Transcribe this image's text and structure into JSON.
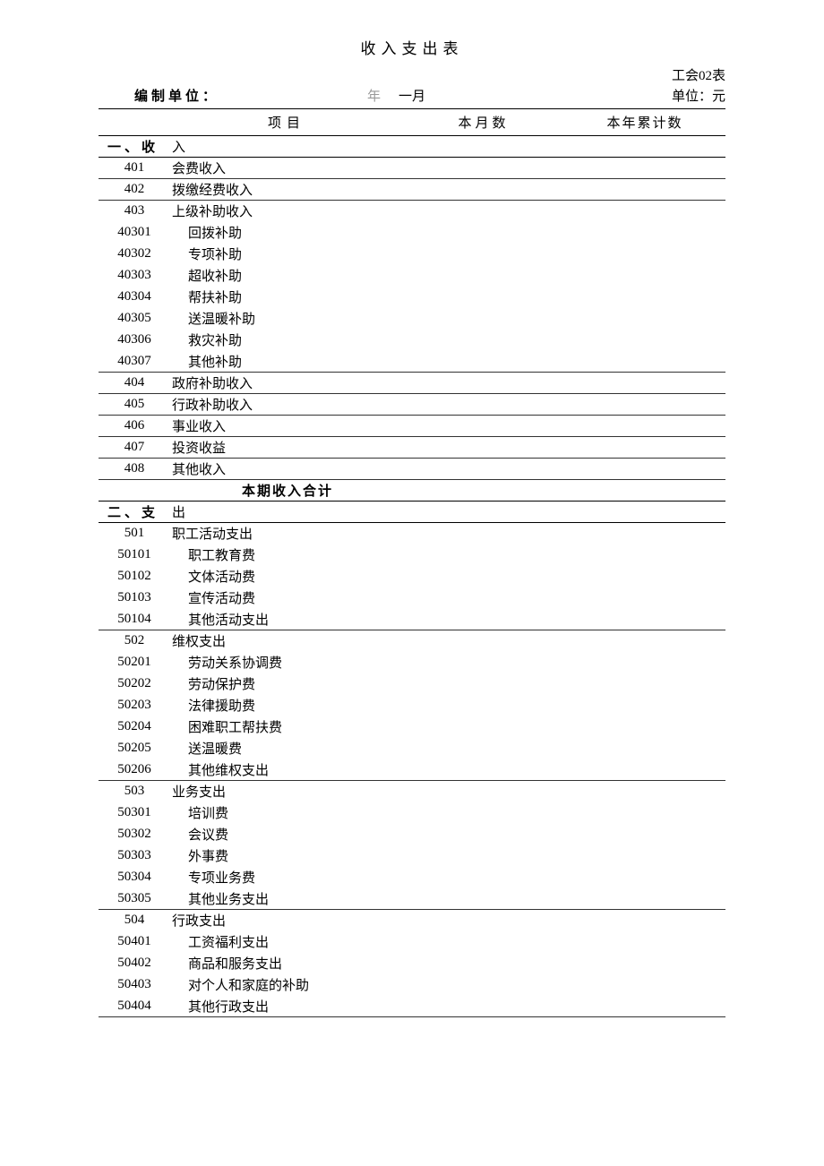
{
  "title": "收入支出表",
  "form_code": "工会02表",
  "org_label": "编制单位：",
  "period_year": "年",
  "period_month": "一月",
  "unit_label": "单位：元",
  "columns": {
    "item": "项目",
    "month": "本月数",
    "year": "本年累计数"
  },
  "sections": [
    {
      "heading_code": "一、收",
      "heading_name": "入",
      "rows": [
        {
          "code": "401",
          "name": "会费收入"
        },
        {
          "code": "402",
          "name": "拨缴经费收入"
        },
        {
          "code": "403",
          "name": "上级补助收入",
          "nb": true
        },
        {
          "code": "40301",
          "name": "回拨补助",
          "sub": true,
          "nb": true
        },
        {
          "code": "40302",
          "name": "专项补助",
          "sub": true,
          "nb": true
        },
        {
          "code": "40303",
          "name": "超收补助",
          "sub": true,
          "nb": true
        },
        {
          "code": "40304",
          "name": "帮扶补助",
          "sub": true,
          "nb": true
        },
        {
          "code": "40305",
          "name": "送温暖补助",
          "sub": true,
          "nb": true
        },
        {
          "code": "40306",
          "name": "救灾补助",
          "sub": true,
          "nb": true
        },
        {
          "code": "40307",
          "name": "其他补助",
          "sub": true
        },
        {
          "code": "404",
          "name": "政府补助收入"
        },
        {
          "code": "405",
          "name": "行政补助收入"
        },
        {
          "code": "406",
          "name": "事业收入"
        },
        {
          "code": "407",
          "name": "投资收益"
        },
        {
          "code": "408",
          "name": "其他收入"
        }
      ],
      "total": "本期收入合计"
    },
    {
      "heading_code": "二、支",
      "heading_name": "出",
      "rows": [
        {
          "code": "501",
          "name": "职工活动支出",
          "nb": true
        },
        {
          "code": "50101",
          "name": "职工教育费",
          "sub": true,
          "nb": true
        },
        {
          "code": "50102",
          "name": "文体活动费",
          "sub": true,
          "nb": true
        },
        {
          "code": "50103",
          "name": "宣传活动费",
          "sub": true,
          "nb": true
        },
        {
          "code": "50104",
          "name": "其他活动支出",
          "sub": true
        },
        {
          "code": "502",
          "name": "维权支出",
          "nb": true
        },
        {
          "code": "50201",
          "name": "劳动关系协调费",
          "sub": true,
          "nb": true
        },
        {
          "code": "50202",
          "name": "劳动保护费",
          "sub": true,
          "nb": true
        },
        {
          "code": "50203",
          "name": "法律援助费",
          "sub": true,
          "nb": true
        },
        {
          "code": "50204",
          "name": "困难职工帮扶费",
          "sub": true,
          "nb": true
        },
        {
          "code": "50205",
          "name": "送温暖费",
          "sub": true,
          "nb": true
        },
        {
          "code": "50206",
          "name": "其他维权支出",
          "sub": true
        },
        {
          "code": "503",
          "name": "业务支出",
          "nb": true
        },
        {
          "code": "50301",
          "name": "培训费",
          "sub": true,
          "nb": true
        },
        {
          "code": "50302",
          "name": "会议费",
          "sub": true,
          "nb": true
        },
        {
          "code": "50303",
          "name": "外事费",
          "sub": true,
          "nb": true
        },
        {
          "code": "50304",
          "name": "专项业务费",
          "sub": true,
          "nb": true
        },
        {
          "code": "50305",
          "name": "其他业务支出",
          "sub": true
        },
        {
          "code": "504",
          "name": "行政支出",
          "nb": true
        },
        {
          "code": "50401",
          "name": "工资福利支出",
          "sub": true,
          "nb": true
        },
        {
          "code": "50402",
          "name": "商品和服务支出",
          "sub": true,
          "nb": true
        },
        {
          "code": "50403",
          "name": "对个人和家庭的补助",
          "sub": true,
          "nb": true
        },
        {
          "code": "50404",
          "name": "其他行政支出",
          "sub": true
        }
      ]
    }
  ]
}
